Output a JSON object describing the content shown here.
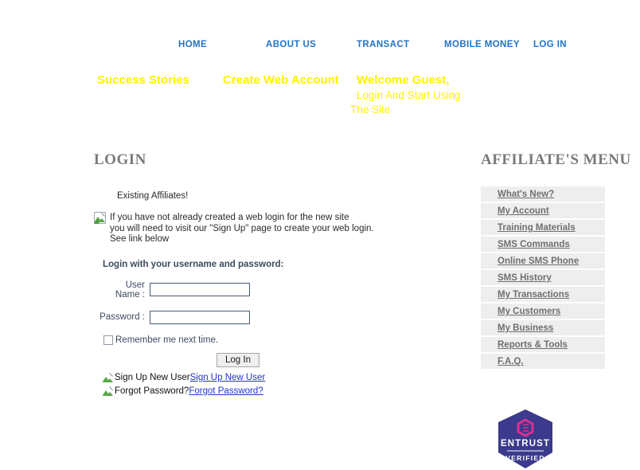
{
  "topnav": {
    "items": [
      {
        "label": "HOME"
      },
      {
        "label": "ABOUT US"
      },
      {
        "label": "TRANSACT"
      },
      {
        "label": "MOBILE MONEY"
      },
      {
        "label": "LOG IN"
      }
    ],
    "color": "#2273c4"
  },
  "promo": {
    "success_stories": "Success Stories",
    "create_web_account": "Create Web Account",
    "welcome": "Welcome Guest,",
    "welcome_line2": "Login And Start Using",
    "welcome_line3": "The Site",
    "color": "#fff200"
  },
  "login": {
    "title": "LOGIN",
    "existing_affiliates": "Existing Affiliates!",
    "notice_line1": "If you have not already created a web login for the new site",
    "notice_line2": "you will need to visit our \"Sign Up\" page to create your web login.",
    "notice_line3": "See link below",
    "login_with": "Login with your username and password:",
    "username_label": "User Name :",
    "username_value": "",
    "password_label": "Password :",
    "password_value": "",
    "remember_label": "Remember me next time.",
    "remember_checked": false,
    "login_button": "Log In",
    "signup_alt": "Sign Up New User",
    "signup_link": "Sign Up New User",
    "forgot_alt": "Forgot Password?",
    "forgot_link": "Forgot Password?"
  },
  "affiliate_menu": {
    "title": "AFFILIATE'S MENU",
    "items": [
      {
        "label": "What's New?"
      },
      {
        "label": "My Account"
      },
      {
        "label": "Training Materials"
      },
      {
        "label": "SMS Commands"
      },
      {
        "label": "Online SMS Phone"
      },
      {
        "label": "SMS History"
      },
      {
        "label": "My Transactions"
      },
      {
        "label": "My Customers"
      },
      {
        "label": "My Business"
      },
      {
        "label": "Reports & Tools"
      },
      {
        "label": "F.A.Q."
      }
    ]
  },
  "entrust_badge": {
    "brand": "ENTRUST",
    "status": "VERIFIED",
    "badge_color": "#3b3a8c",
    "mark_color": "#d9308f"
  }
}
